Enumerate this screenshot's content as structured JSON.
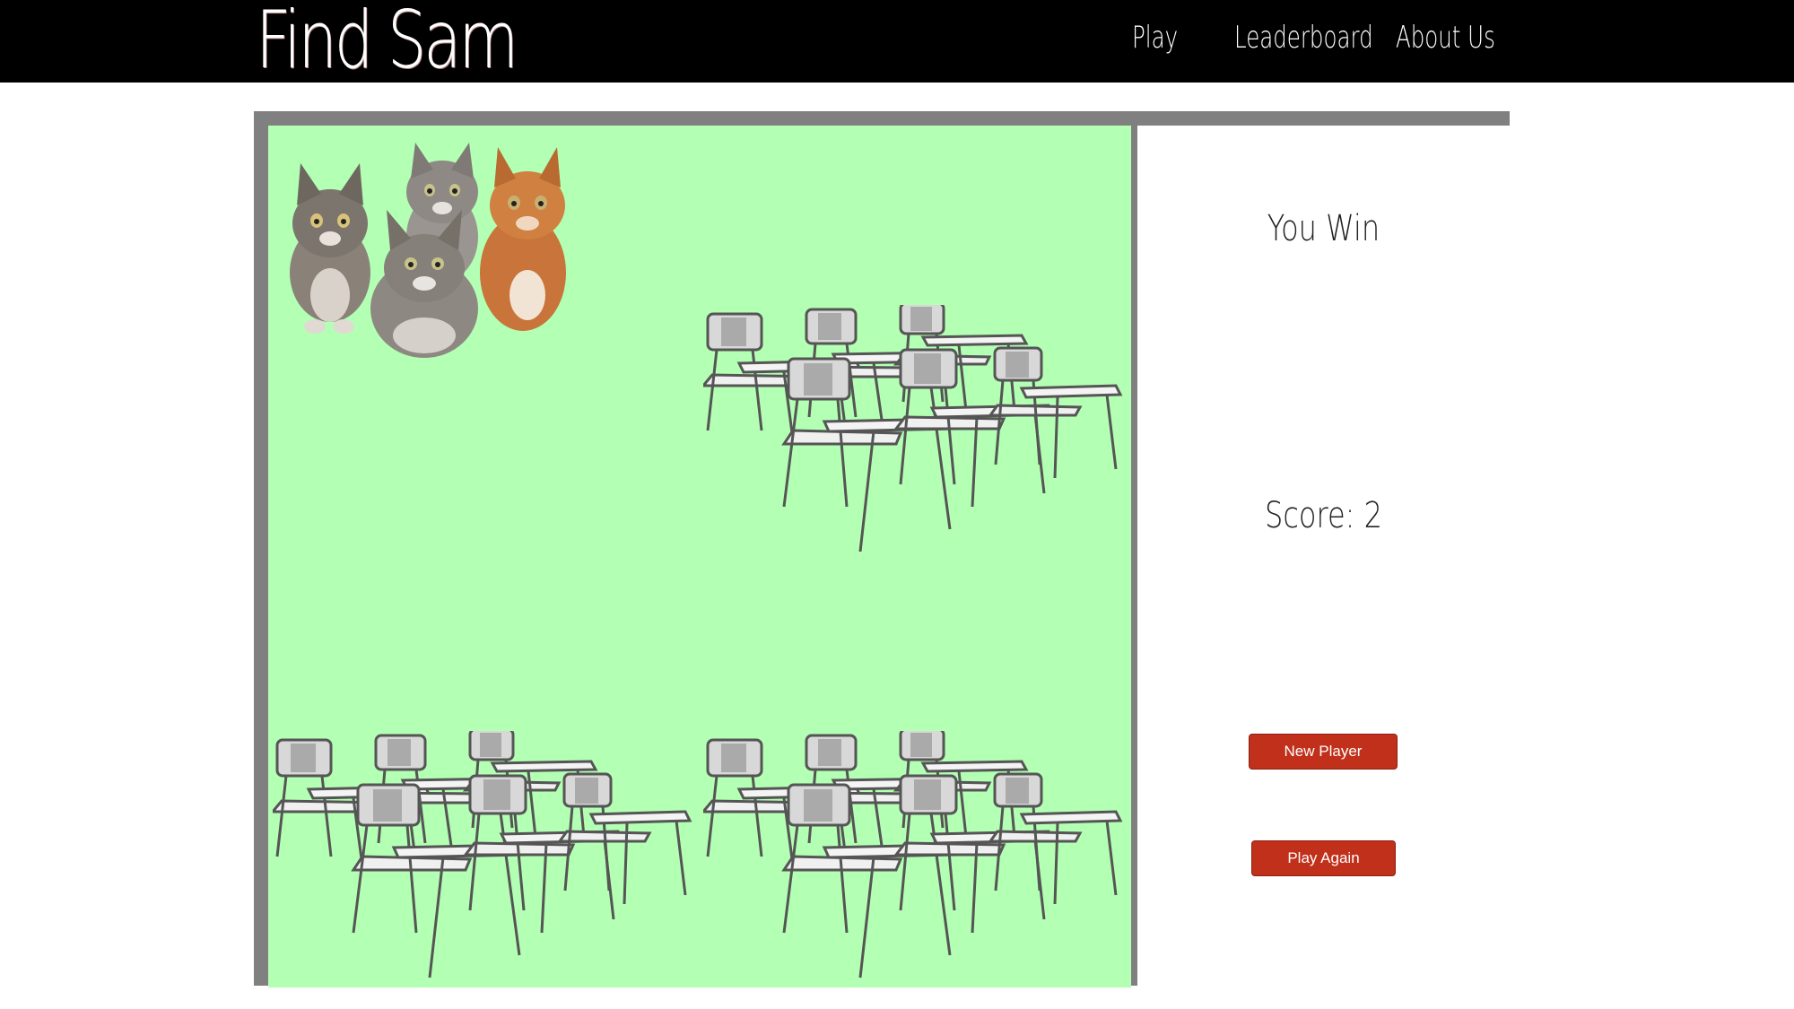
{
  "nav": {
    "brand": "Find Sam",
    "links": [
      {
        "label": "Play"
      },
      {
        "label": "Leaderboard"
      },
      {
        "label": "About Us"
      }
    ]
  },
  "game": {
    "play_area_color": "#b3ffb3",
    "sprites": [
      "kittens",
      "desk-group",
      "desk-group",
      "desk-group"
    ]
  },
  "panel": {
    "status": "You Win",
    "score": "Score: 2",
    "new_player_label": "New Player",
    "play_again_label": "Play Again",
    "button_color": "#c0301a"
  }
}
